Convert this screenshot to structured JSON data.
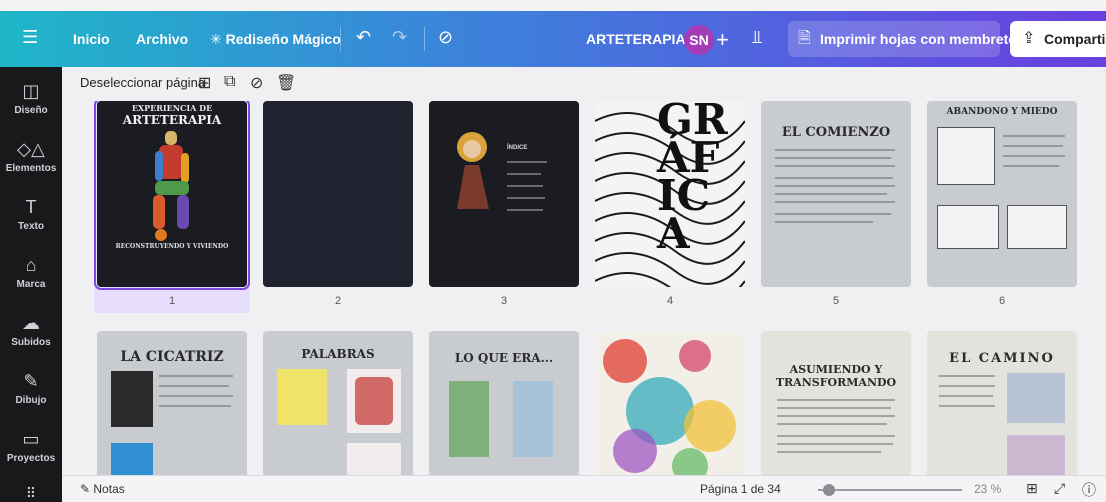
{
  "topbar": {
    "menu_icon": "hamburger-icon",
    "inicio": "Inicio",
    "archivo": "Archivo",
    "rediseno": "Rediseño Mágico",
    "undo_icon": "undo-icon",
    "redo_icon": "redo-icon",
    "cloud_icon": "cloud-saved-icon",
    "project_title": "ARTETERAPIA",
    "avatar_initials": "SN",
    "chart_icon": "bar-chart-icon",
    "print_label": "Imprimir hojas con membretes",
    "share_label": "Compartir",
    "gradient_start": "#1fb6c8",
    "gradient_end": "#6a3fe0"
  },
  "sidebar": {
    "items": [
      {
        "label": "Diseño",
        "icon": "layout-icon"
      },
      {
        "label": "Elementos",
        "icon": "shapes-icon"
      },
      {
        "label": "Texto",
        "icon": "text-icon"
      },
      {
        "label": "Marca",
        "icon": "brand-icon"
      },
      {
        "label": "Subidos",
        "icon": "upload-cloud-icon"
      },
      {
        "label": "Dibujo",
        "icon": "draw-icon"
      },
      {
        "label": "Proyectos",
        "icon": "folder-icon"
      }
    ]
  },
  "pagebar": {
    "deselect": "Deseleccionar página"
  },
  "pages": [
    {
      "number": "1",
      "title_a": "EXPERIENCIA DE",
      "title_b": "ARTETERAPIA",
      "footer": "RECONSTRUYENDO Y VIVIENDO"
    },
    {
      "number": "2"
    },
    {
      "number": "3",
      "title": "ÍNDICE"
    },
    {
      "number": "4",
      "title": "GRÁFICA"
    },
    {
      "number": "5",
      "title": "EL COMIENZO"
    },
    {
      "number": "6",
      "title": "ABANDONO Y MIEDO"
    },
    {
      "title": "LA CICATRIZ"
    },
    {
      "title": "PALABRAS"
    },
    {
      "title": "LO QUE ERA..."
    },
    {
      "title": ""
    },
    {
      "title": "ASUMIENDO Y TRANSFORMANDO"
    },
    {
      "title": "EL CAMINO"
    }
  ],
  "bottombar": {
    "notes": "Notas",
    "page_indicator": "Página 1 de 34",
    "zoom": "23 %",
    "zoom_fraction": 0.04,
    "grid_icon": "grid-view-icon",
    "fullscreen_icon": "fullscreen-icon",
    "help_icon": "help-icon"
  }
}
